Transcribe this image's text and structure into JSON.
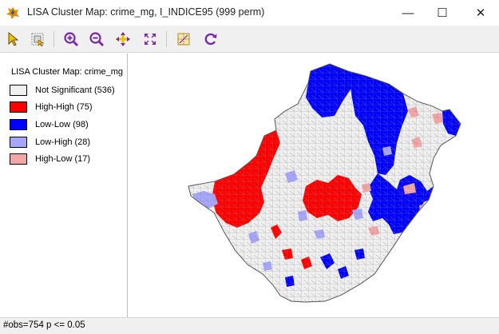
{
  "window": {
    "title": "LISA Cluster Map: crime_mg, I_INDICE95 (999 perm)",
    "app_icon": "geoda-icon",
    "controls": {
      "minimize": "—",
      "maximize": "☐",
      "close": "✕"
    }
  },
  "toolbar": {
    "buttons": [
      {
        "name": "select-pointer-icon"
      },
      {
        "name": "select-region-icon"
      },
      {
        "name": "zoom-in-icon"
      },
      {
        "name": "zoom-out-icon"
      },
      {
        "name": "pan-icon"
      },
      {
        "name": "fit-to-window-icon"
      },
      {
        "name": "map-layers-icon"
      },
      {
        "name": "refresh-icon"
      }
    ]
  },
  "legend": {
    "title": "LISA Cluster Map: crime_mg",
    "items": [
      {
        "label": "Not Significant (536)",
        "color": "#efefef"
      },
      {
        "label": "High-High (75)",
        "color": "#ff0000"
      },
      {
        "label": "Low-Low (98)",
        "color": "#0000ff"
      },
      {
        "label": "Low-High (28)",
        "color": "#a7a6fd"
      },
      {
        "label": "High-Low (17)",
        "color": "#f4a6a6"
      }
    ]
  },
  "map": {
    "colors": {
      "not_significant": "#efefef",
      "high_high": "#ff0000",
      "low_low": "#0000ff",
      "low_high": "#a7a6fd",
      "high_low": "#f4a6a6",
      "border": "#8a8a8a"
    }
  },
  "status": {
    "text": "#obs=754  p <= 0.05"
  }
}
